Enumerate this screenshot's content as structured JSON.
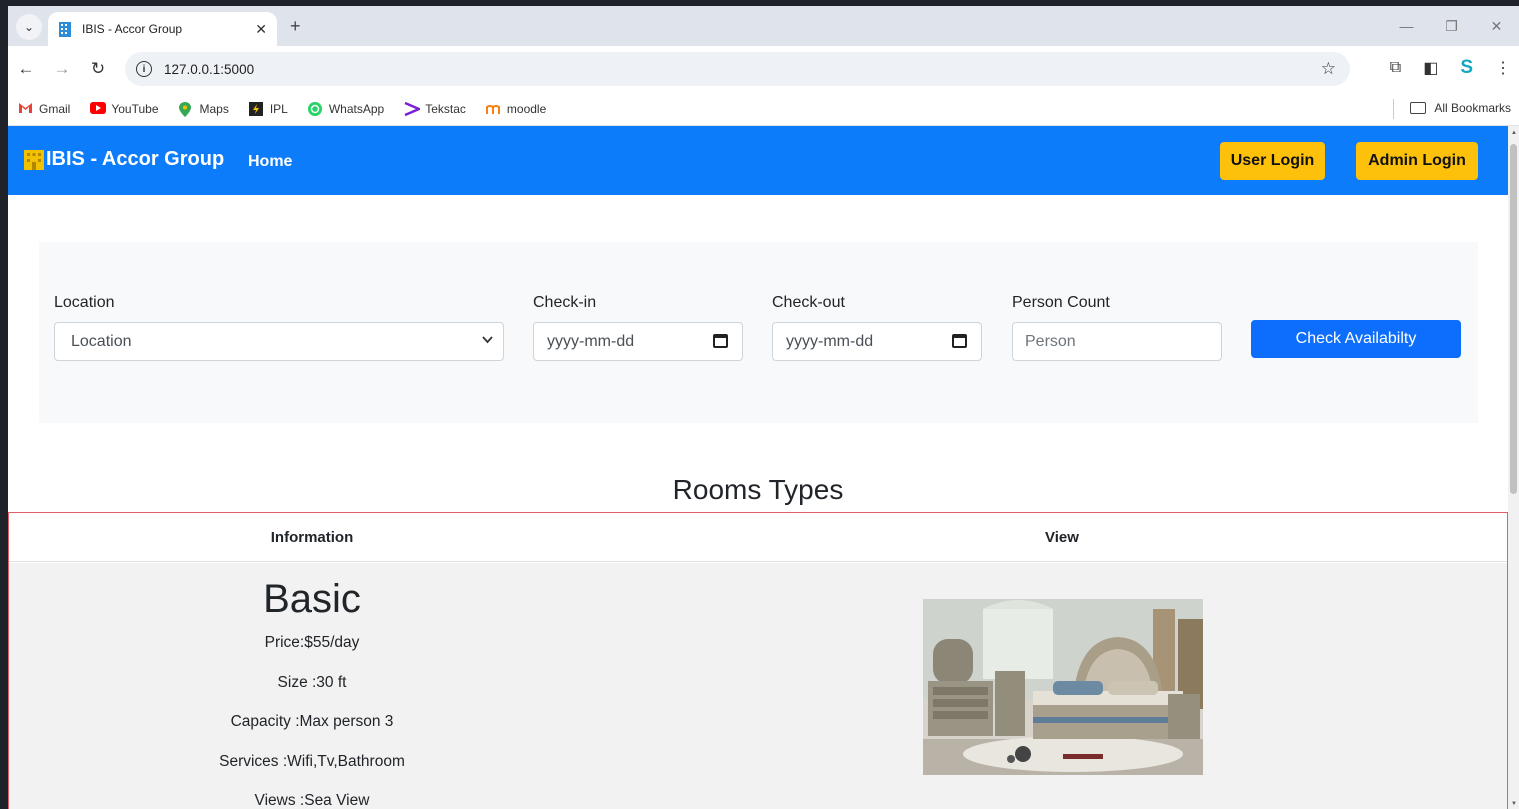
{
  "browser": {
    "tab_title": "IBIS - Accor Group",
    "url": "127.0.0.1:5000",
    "bookmarks": [
      {
        "label": "Gmail",
        "icon": "gmail-icon"
      },
      {
        "label": "YouTube",
        "icon": "youtube-icon"
      },
      {
        "label": "Maps",
        "icon": "maps-icon"
      },
      {
        "label": "IPL",
        "icon": "ipl-icon"
      },
      {
        "label": "WhatsApp",
        "icon": "whatsapp-icon"
      },
      {
        "label": "Tekstac",
        "icon": "tekstac-icon"
      },
      {
        "label": "moodle",
        "icon": "moodle-icon"
      }
    ],
    "all_bookmarks": "All Bookmarks"
  },
  "navbar": {
    "brand": "IBIS - Accor Group",
    "home": "Home",
    "user_login": "User Login",
    "admin_login": "Admin Login",
    "color": "#0d7cfb"
  },
  "search": {
    "location_label": "Location",
    "location_value": "Location",
    "checkin_label": "Check-in",
    "checkin_placeholder": "yyyy-mm-dd",
    "checkout_label": "Check-out",
    "checkout_placeholder": "yyyy-mm-dd",
    "person_label": "Person Count",
    "person_placeholder": "Person",
    "submit": "Check Availabilty"
  },
  "rooms": {
    "title": "Rooms Types",
    "columns": [
      "Information",
      "View"
    ],
    "items": [
      {
        "name": "Basic",
        "price": "Price:$55/day",
        "size": "Size :30 ft",
        "capacity": "Capacity :Max person 3",
        "services": "Services :Wifi,Tv,Bathroom",
        "views": "Views :Sea View"
      }
    ]
  }
}
